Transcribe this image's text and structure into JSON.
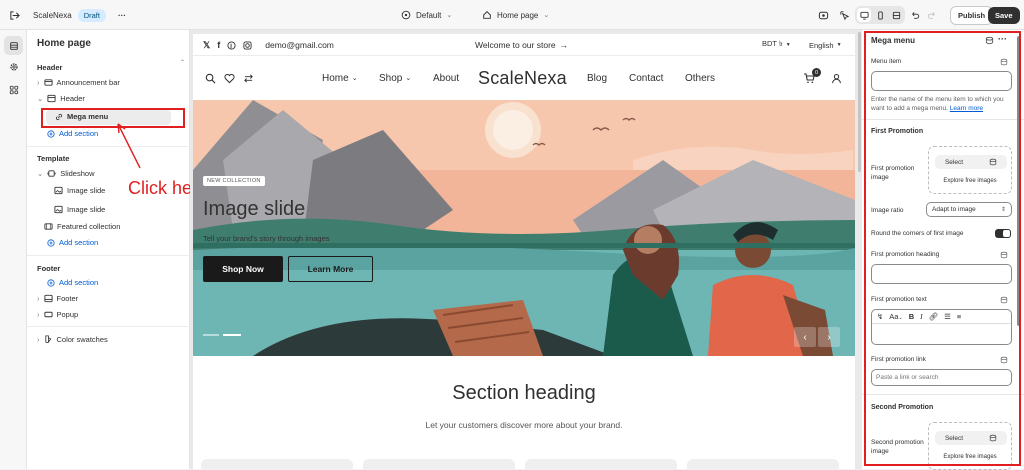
{
  "topbar": {
    "store_name": "ScaleNexa",
    "status_badge": "Draft",
    "more": "···",
    "theme_select": "Default",
    "page_select": "Home page",
    "publish_label": "Publish",
    "save_label": "Save"
  },
  "left_panel": {
    "title": "Home page",
    "header_group": "Header",
    "header_items": [
      {
        "label": "Announcement bar"
      },
      {
        "label": "Header"
      },
      {
        "label": "Mega menu"
      }
    ],
    "add_section": "Add section",
    "template_group": "Template",
    "template_items": [
      {
        "label": "Slideshow"
      },
      {
        "label": "Image slide"
      },
      {
        "label": "Image slide"
      },
      {
        "label": "Featured collection"
      }
    ],
    "footer_group": "Footer",
    "footer_items": [
      {
        "label": "Footer"
      },
      {
        "label": "Popup"
      }
    ],
    "color_swatches": "Color swatches",
    "annotation": "Click here"
  },
  "store": {
    "utility": {
      "email": "demo@gmail.com",
      "welcome": "Welcome to our store",
      "currency": "BDT ৳",
      "language": "English"
    },
    "nav": {
      "logo": "ScaleNexa",
      "items": [
        "Home",
        "Shop",
        "About",
        "Blog",
        "Contact",
        "Others"
      ],
      "cart_count": "0"
    },
    "hero": {
      "tag": "NEW COLLECTION",
      "heading": "Image slide",
      "subheading": "Tell your brand's story through images",
      "primary_button": "Shop Now",
      "secondary_button": "Learn More"
    },
    "section": {
      "heading": "Section heading",
      "subheading": "Let your customers discover more about your brand."
    }
  },
  "settings": {
    "title": "Mega menu",
    "more": "···",
    "menu_item_label": "Menu item",
    "menu_item_value": "",
    "menu_item_help": "Enter the name of the menu item to which you want to add a mega menu.",
    "learn_more": "Learn more",
    "first_promotion": "First Promotion",
    "first_image_label": "First promotion image",
    "select_label": "Select",
    "explore_label": "Explore free images",
    "image_ratio_label": "Image ratio",
    "image_ratio_value": "Adapt to image",
    "round_corners_label": "Round the corners of first image",
    "round_corners_on": true,
    "first_heading_label": "First promotion heading",
    "first_text_label": "First promotion text",
    "rte_font": "Aa",
    "first_link_label": "First promotion link",
    "first_link_placeholder": "Paste a link or search",
    "second_promotion": "Second Promotion",
    "second_image_label": "Second promotion image"
  },
  "colors": {
    "highlight": "#e02020",
    "link": "#005bd3",
    "primary_dark": "#303030"
  }
}
